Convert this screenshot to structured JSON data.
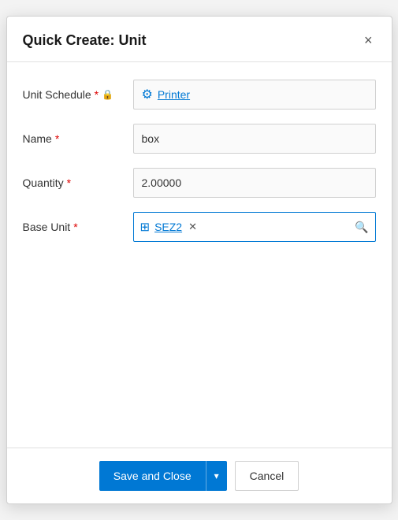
{
  "dialog": {
    "title": "Quick Create: Unit",
    "close_label": "×"
  },
  "form": {
    "unit_schedule": {
      "label": "Unit Schedule",
      "required": true,
      "locked": true,
      "value": "Printer",
      "icon": "link-icon"
    },
    "name": {
      "label": "Name",
      "required": true,
      "value": "box",
      "placeholder": ""
    },
    "quantity": {
      "label": "Quantity",
      "required": true,
      "value": "2.00000",
      "placeholder": ""
    },
    "base_unit": {
      "label": "Base Unit",
      "required": true,
      "value": "SEZ2",
      "icon": "unit-icon"
    }
  },
  "footer": {
    "save_and_close": "Save and Close",
    "cancel": "Cancel",
    "dropdown_arrow": "▾"
  }
}
